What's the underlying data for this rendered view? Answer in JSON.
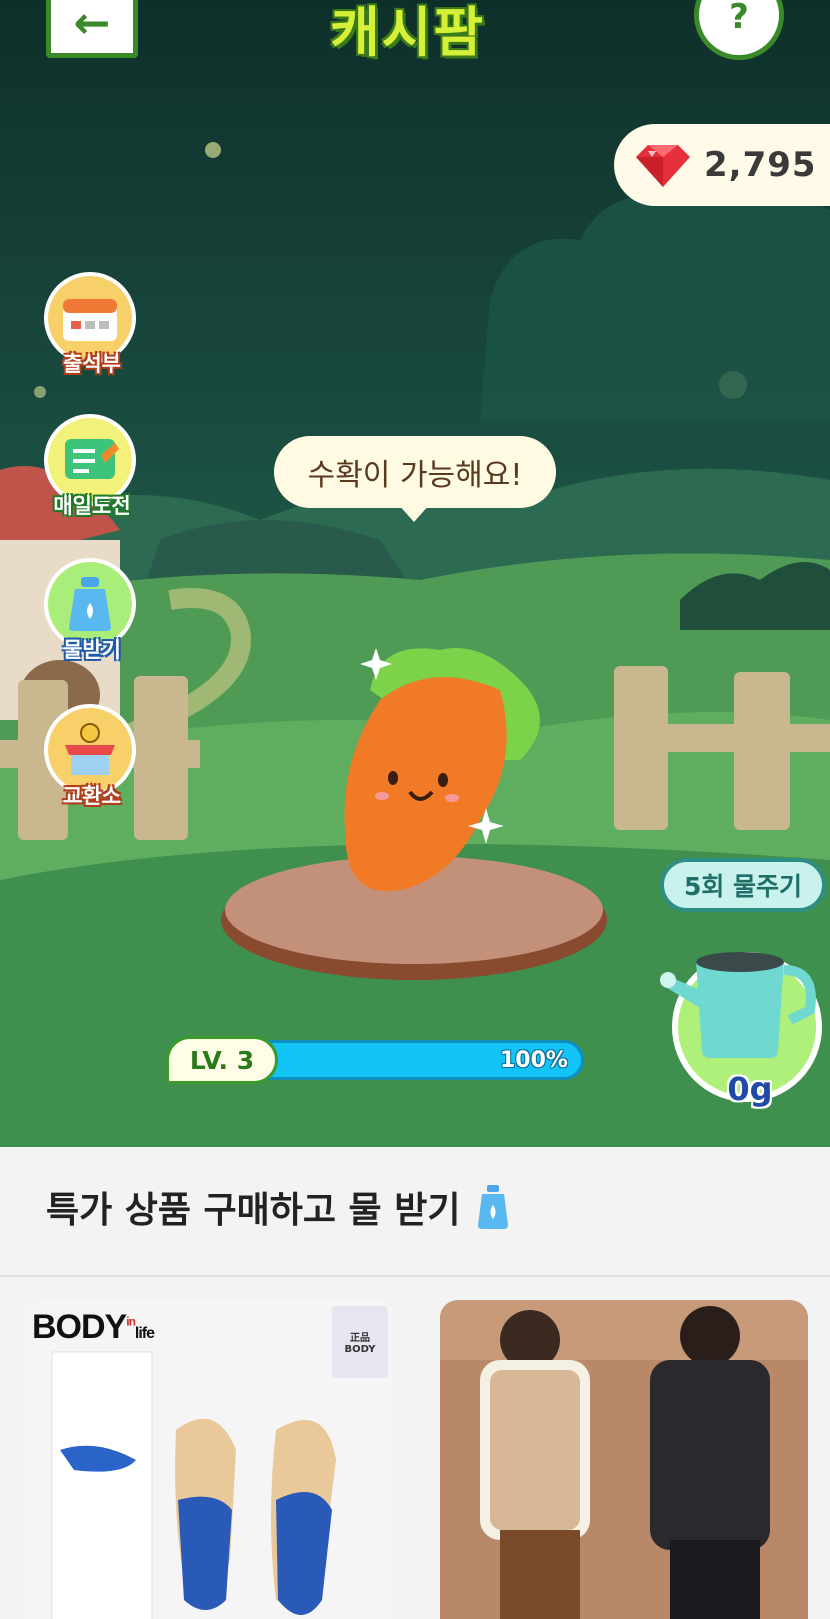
{
  "header": {
    "back_icon": "←",
    "logo_text": "캐시팜",
    "help_icon": "?"
  },
  "currency": {
    "gem_icon": "ruby-gem-icon",
    "value": "2,795"
  },
  "side_menu": [
    {
      "label": "출석부",
      "icon": "calendar-icon"
    },
    {
      "label": "매일도전",
      "icon": "checklist-icon"
    },
    {
      "label": "물받기",
      "icon": "water-bottle-icon"
    },
    {
      "label": "교환소",
      "icon": "shop-icon"
    }
  ],
  "speech_bubble": "수확이 가능해요!",
  "water": {
    "count_label": "5회 물주기",
    "amount": "0g"
  },
  "level": {
    "label": "LV. 3",
    "progress_text": "100%",
    "progress": 1.0
  },
  "shop": {
    "title": "특가 상품 구매하고 물 받기",
    "products": [
      {
        "brand": "BODY",
        "brand_sub": "life",
        "brand_in": "in",
        "badge": "正品",
        "badge_brand": "BODY"
      },
      {
        "brand": ""
      }
    ]
  },
  "colors": {
    "accent_green": "#3a8a2a",
    "progress_blue": "#12c4f5",
    "gem_red": "#e52f3a"
  }
}
